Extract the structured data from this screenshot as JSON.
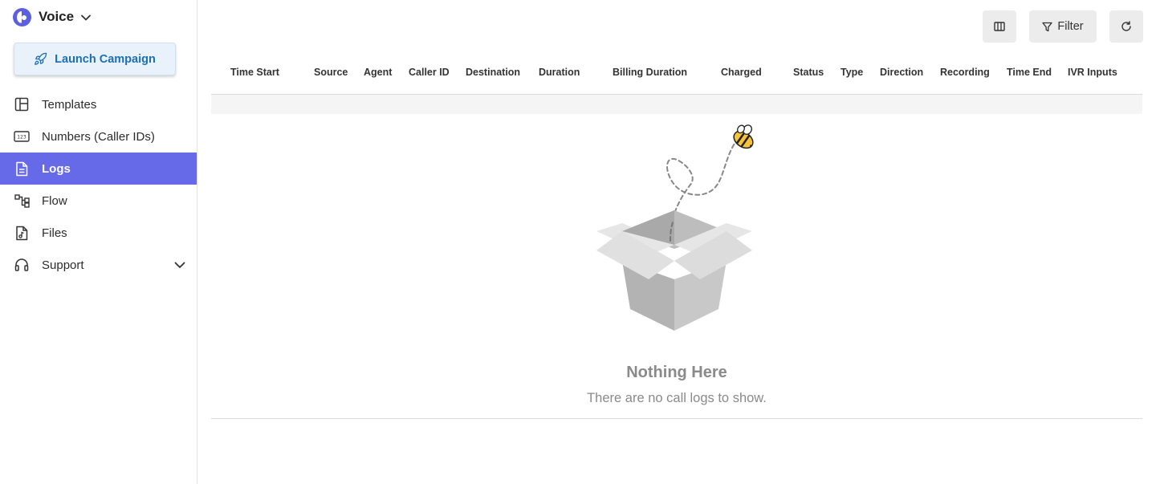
{
  "app": {
    "name": "Voice"
  },
  "sidebar": {
    "launch_label": "Launch Campaign",
    "items": [
      {
        "label": "Templates",
        "icon": "layout-icon",
        "active": false
      },
      {
        "label": "Numbers (Caller IDs)",
        "icon": "numbers-icon",
        "active": false
      },
      {
        "label": "Logs",
        "icon": "document-icon",
        "active": true
      },
      {
        "label": "Flow",
        "icon": "flow-icon",
        "active": false
      },
      {
        "label": "Files",
        "icon": "audio-file-icon",
        "active": false
      },
      {
        "label": "Support",
        "icon": "headset-icon",
        "active": false
      }
    ]
  },
  "toolbar": {
    "filter_label": "Filter"
  },
  "table": {
    "columns": [
      "Time Start",
      "Source",
      "Agent",
      "Caller ID",
      "Destination",
      "Duration",
      "Billing Duration",
      "Charged",
      "Status",
      "Type",
      "Direction",
      "Recording",
      "Time End",
      "IVR Inputs"
    ]
  },
  "empty_state": {
    "title": "Nothing Here",
    "message": "There are no call logs to show."
  },
  "colors": {
    "accent": "#676ae8",
    "launch_text": "#1a6fb5"
  }
}
